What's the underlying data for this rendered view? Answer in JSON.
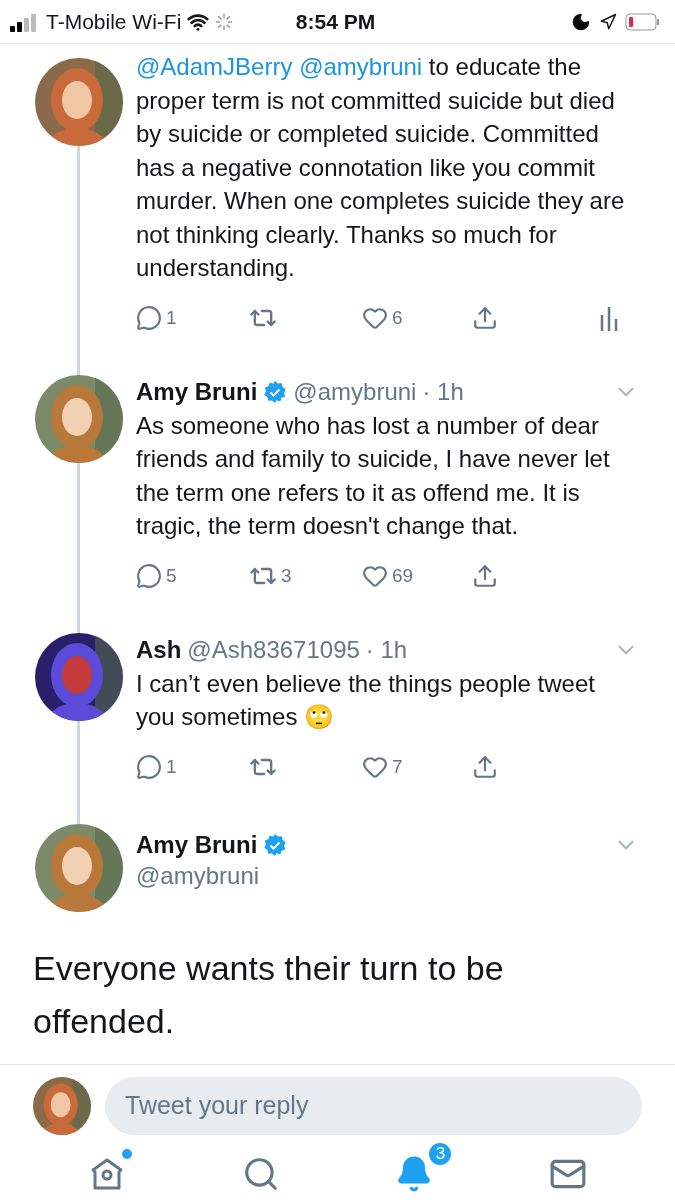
{
  "status_bar": {
    "carrier": "T-Mobile Wi-Fi",
    "time": "8:54 PM"
  },
  "replies": [
    {
      "avatar": {
        "kind": "picture"
      },
      "body": [
        {
          "kind": "mention",
          "text": "@AdamJBerry"
        },
        {
          "kind": "mention",
          "text": "@amybruni"
        },
        {
          "kind": "text",
          "text": " to educate the proper term is not committed suicide but died by suicide or completed suicide. Committed has a negative connotation like you commit murder. When one completes suicide they are not thinking clearly. Thanks so much for understanding."
        }
      ],
      "actions": {
        "reply": "1",
        "like": "6",
        "analytics": true
      }
    },
    {
      "avatar": {
        "kind": "picture"
      },
      "name": "Amy Bruni",
      "verified": true,
      "handle": "@amybruni",
      "time": "· 1h",
      "body": [
        {
          "kind": "text",
          "text": "As someone who has lost a number of dear friends and family to suicide, I have never let the term one refers to it as offend me. It is tragic, the term doesn't change that."
        }
      ],
      "actions": {
        "reply": "5",
        "retweet": "3",
        "like": "69",
        "analytics": false
      }
    },
    {
      "avatar": {
        "kind": "picture"
      },
      "name": "Ash",
      "verified": false,
      "handle": "@Ash83671095",
      "time": "· 1h",
      "body": [
        {
          "kind": "text",
          "text": "I can’t even believe the things people tweet you sometimes 🙄"
        }
      ],
      "actions": {
        "reply": "1",
        "like": "7",
        "analytics": false
      }
    }
  ],
  "main_tweet": {
    "avatar": {
      "kind": "picture"
    },
    "name": "Amy Bruni",
    "verified": true,
    "handle": "@amybruni",
    "body": "Everyone wants their turn to be offended."
  },
  "reply_bar": {
    "avatar": {
      "kind": "picture"
    },
    "placeholder": "Tweet your reply"
  },
  "tab_bar": [
    {
      "kind": "home",
      "selected": false,
      "dot": true
    },
    {
      "kind": "search",
      "selected": false,
      "dot": false
    },
    {
      "kind": "notifications",
      "selected": true,
      "dot": false,
      "badge": "3"
    },
    {
      "kind": "messages",
      "selected": false,
      "dot": false
    }
  ]
}
